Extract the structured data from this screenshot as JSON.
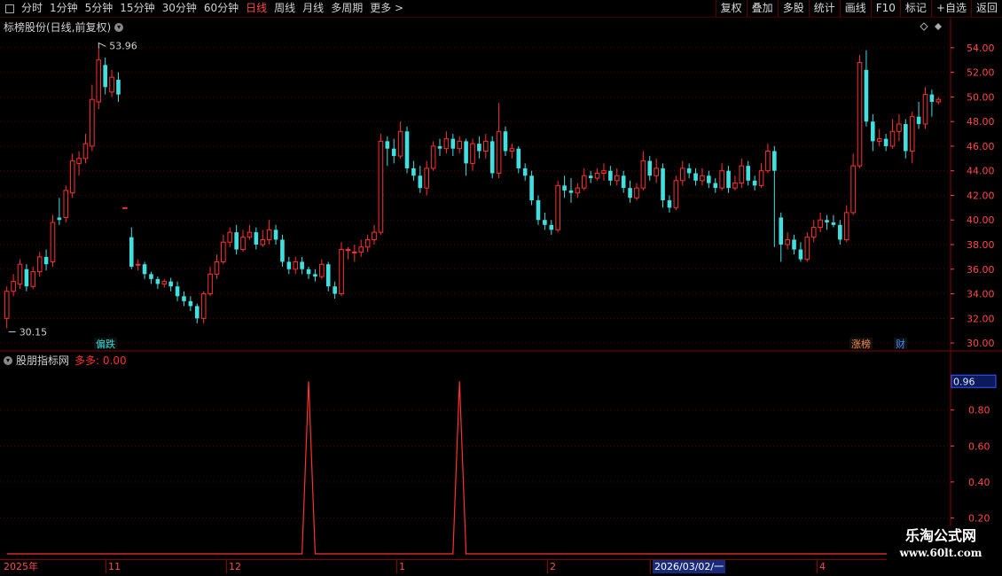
{
  "toolbar": {
    "periods": [
      "分时",
      "1分钟",
      "5分钟",
      "15分钟",
      "30分钟",
      "60分钟",
      "日线",
      "周线",
      "月线",
      "多周期",
      "更多 >"
    ],
    "active_period": "日线",
    "buttons": [
      "复权",
      "叠加",
      "多股",
      "统计",
      "画线",
      "F10",
      "标记",
      "+自选",
      "返回"
    ]
  },
  "main": {
    "title": "标榜股份(日线,前复权)",
    "high_label": "53.96",
    "low_label": "30.15",
    "y_ticks": [
      "54.00",
      "52.00",
      "50.00",
      "48.00",
      "46.00",
      "44.00",
      "42.00",
      "40.00",
      "38.00",
      "36.00",
      "34.00",
      "32.00",
      "30.00"
    ],
    "markers": [
      {
        "label": "偏跌",
        "color": "#33dddd"
      },
      {
        "label": "涨榜",
        "color": "#ff8a4a"
      },
      {
        "label": "财",
        "color": "#3b8cff"
      }
    ]
  },
  "sub": {
    "title": "股朋指标网",
    "indicator": "多多: 0.00",
    "value_box": "0.96",
    "y_ticks": [
      "0.80",
      "0.60",
      "0.40",
      "0.20"
    ]
  },
  "dates": {
    "labels": [
      "2025年",
      "11",
      "12",
      "1",
      "2",
      "2026/03/02/一",
      "4"
    ]
  },
  "logo": {
    "line1": "乐淘公式网",
    "line2": "www.60lt.com"
  },
  "colors": {
    "up": "#ff3030",
    "down": "#40e0e0",
    "grid": "#8a0000",
    "axis": "#ff4848",
    "sub_line": "#ff3030"
  },
  "chart_data": {
    "type": "candlestick",
    "ylim": [
      29.5,
      55
    ],
    "candles": [
      [
        32.0,
        34.2,
        34.6,
        31.2
      ],
      [
        34.2,
        35.0,
        35.6,
        33.8
      ],
      [
        34.8,
        36.4,
        36.8,
        34.4
      ],
      [
        36.0,
        34.6,
        36.4,
        34.2
      ],
      [
        34.6,
        35.8,
        36.2,
        34.4
      ],
      [
        35.8,
        37.0,
        37.4,
        35.4
      ],
      [
        37.0,
        36.4,
        37.6,
        35.9
      ],
      [
        36.6,
        39.8,
        40.4,
        36.2
      ],
      [
        40.2,
        40.0,
        41.8,
        39.6
      ],
      [
        40.2,
        42.4,
        42.8,
        39.8
      ],
      [
        42.2,
        44.8,
        45.4,
        41.8
      ],
      [
        44.6,
        45.0,
        45.6,
        43.6
      ],
      [
        45.0,
        46.2,
        47.0,
        44.6
      ],
      [
        46.0,
        49.8,
        51.0,
        45.6
      ],
      [
        49.6,
        53.0,
        53.96,
        49.0
      ],
      [
        52.6,
        50.8,
        53.2,
        50.2
      ],
      [
        50.4,
        51.6,
        52.2,
        50.0
      ],
      [
        51.4,
        50.2,
        52.0,
        49.6
      ],
      [
        41.0,
        41.0,
        41.0,
        41.0
      ],
      [
        38.6,
        36.2,
        39.4,
        36.0
      ],
      [
        36.4,
        36.4,
        36.8,
        35.9
      ],
      [
        36.4,
        35.6,
        36.6,
        35.2
      ],
      [
        35.6,
        35.2,
        35.8,
        34.8
      ],
      [
        35.2,
        34.8,
        35.4,
        34.4
      ],
      [
        34.8,
        35.0,
        35.2,
        34.5
      ],
      [
        35.0,
        34.6,
        35.3,
        34.2
      ],
      [
        34.6,
        33.8,
        35.0,
        33.4
      ],
      [
        33.8,
        33.4,
        34.2,
        33.0
      ],
      [
        33.4,
        33.0,
        33.8,
        32.6
      ],
      [
        33.0,
        32.0,
        33.2,
        31.6
      ],
      [
        32.0,
        34.0,
        34.2,
        31.6
      ],
      [
        34.0,
        35.6,
        36.2,
        33.8
      ],
      [
        35.6,
        36.6,
        37.2,
        35.2
      ],
      [
        36.6,
        38.2,
        38.8,
        36.4
      ],
      [
        38.2,
        39.0,
        39.4,
        37.8
      ],
      [
        39.0,
        37.6,
        39.6,
        37.2
      ],
      [
        37.6,
        38.6,
        39.2,
        37.4
      ],
      [
        38.6,
        39.0,
        39.6,
        38.4
      ],
      [
        39.0,
        38.0,
        39.4,
        37.6
      ],
      [
        38.0,
        38.4,
        39.2,
        37.8
      ],
      [
        38.4,
        39.2,
        40.0,
        38.0
      ],
      [
        39.2,
        38.4,
        39.6,
        38.0
      ],
      [
        38.4,
        36.6,
        38.8,
        36.2
      ],
      [
        36.6,
        36.0,
        37.0,
        35.6
      ],
      [
        36.0,
        36.6,
        37.0,
        35.6
      ],
      [
        36.6,
        36.0,
        37.0,
        35.6
      ],
      [
        36.0,
        35.6,
        36.2,
        35.2
      ],
      [
        35.6,
        35.4,
        36.0,
        35.0
      ],
      [
        35.4,
        36.4,
        36.8,
        35.2
      ],
      [
        36.4,
        34.6,
        36.6,
        34.2
      ],
      [
        34.6,
        34.0,
        35.0,
        33.6
      ],
      [
        34.0,
        37.6,
        38.2,
        33.8
      ],
      [
        37.6,
        37.6,
        37.8,
        36.8
      ],
      [
        37.4,
        37.4,
        38.0,
        36.6
      ],
      [
        37.4,
        37.8,
        38.4,
        37.0
      ],
      [
        37.8,
        38.4,
        38.8,
        37.4
      ],
      [
        38.4,
        39.0,
        39.6,
        38.0
      ],
      [
        39.0,
        46.4,
        47.0,
        38.8
      ],
      [
        46.4,
        45.8,
        46.8,
        44.4
      ],
      [
        45.8,
        45.2,
        46.6,
        44.6
      ],
      [
        45.2,
        47.2,
        48.0,
        45.0
      ],
      [
        47.2,
        44.2,
        47.6,
        43.8
      ],
      [
        44.2,
        43.6,
        44.8,
        43.2
      ],
      [
        43.6,
        42.6,
        44.4,
        42.2
      ],
      [
        42.6,
        44.2,
        44.8,
        42.0
      ],
      [
        44.2,
        46.0,
        46.4,
        44.0
      ],
      [
        46.0,
        45.8,
        46.6,
        45.2
      ],
      [
        45.8,
        46.6,
        47.2,
        45.4
      ],
      [
        46.6,
        45.8,
        47.0,
        45.2
      ],
      [
        45.8,
        46.4,
        46.8,
        45.4
      ],
      [
        46.4,
        44.6,
        46.6,
        43.6
      ],
      [
        44.6,
        46.2,
        46.6,
        44.0
      ],
      [
        46.2,
        45.6,
        46.8,
        45.0
      ],
      [
        45.6,
        46.4,
        47.0,
        45.0
      ],
      [
        46.4,
        43.8,
        46.8,
        43.4
      ],
      [
        43.8,
        47.2,
        49.5,
        43.4
      ],
      [
        47.2,
        45.6,
        47.6,
        45.2
      ],
      [
        45.6,
        45.8,
        46.2,
        45.0
      ],
      [
        45.8,
        44.2,
        46.0,
        43.8
      ],
      [
        44.2,
        43.6,
        44.6,
        43.2
      ],
      [
        43.6,
        41.6,
        44.0,
        41.2
      ],
      [
        41.6,
        40.0,
        42.0,
        39.6
      ],
      [
        40.0,
        39.6,
        40.6,
        39.2
      ],
      [
        39.6,
        39.2,
        40.0,
        38.8
      ],
      [
        39.2,
        42.8,
        43.2,
        39.0
      ],
      [
        42.8,
        42.4,
        43.6,
        41.8
      ],
      [
        42.4,
        42.2,
        43.4,
        41.4
      ],
      [
        42.2,
        42.6,
        43.0,
        41.8
      ],
      [
        42.6,
        43.6,
        44.2,
        42.4
      ],
      [
        43.6,
        43.4,
        44.0,
        43.0
      ],
      [
        43.4,
        43.8,
        44.2,
        43.2
      ],
      [
        43.8,
        44.0,
        44.6,
        43.2
      ],
      [
        44.0,
        43.2,
        44.4,
        42.8
      ],
      [
        43.2,
        43.6,
        44.2,
        42.8
      ],
      [
        43.6,
        42.6,
        44.0,
        42.2
      ],
      [
        42.6,
        41.8,
        43.2,
        41.4
      ],
      [
        41.8,
        42.6,
        43.0,
        41.6
      ],
      [
        42.6,
        44.8,
        45.6,
        42.4
      ],
      [
        44.8,
        43.6,
        45.2,
        43.2
      ],
      [
        43.6,
        44.2,
        45.0,
        43.0
      ],
      [
        44.2,
        41.6,
        44.6,
        41.0
      ],
      [
        41.6,
        41.0,
        42.0,
        40.6
      ],
      [
        41.0,
        43.2,
        43.6,
        40.8
      ],
      [
        43.2,
        44.2,
        44.8,
        42.8
      ],
      [
        44.2,
        43.8,
        44.6,
        43.4
      ],
      [
        43.8,
        43.2,
        44.2,
        42.8
      ],
      [
        43.2,
        43.6,
        44.2,
        42.8
      ],
      [
        43.6,
        43.0,
        44.0,
        42.6
      ],
      [
        43.0,
        42.6,
        43.4,
        42.2
      ],
      [
        42.6,
        44.0,
        44.6,
        42.4
      ],
      [
        44.0,
        42.6,
        44.4,
        42.2
      ],
      [
        42.6,
        43.0,
        43.6,
        42.4
      ],
      [
        43.0,
        44.4,
        45.0,
        42.6
      ],
      [
        44.4,
        43.2,
        44.8,
        42.8
      ],
      [
        43.2,
        42.8,
        43.6,
        42.4
      ],
      [
        42.8,
        44.0,
        44.6,
        42.6
      ],
      [
        44.0,
        45.6,
        46.2,
        43.8
      ],
      [
        45.6,
        44.0,
        46.0,
        37.8
      ],
      [
        40.2,
        38.0,
        40.6,
        36.6
      ],
      [
        38.0,
        38.4,
        39.0,
        37.6
      ],
      [
        38.4,
        37.6,
        38.8,
        37.2
      ],
      [
        37.6,
        36.8,
        38.2,
        36.6
      ],
      [
        36.8,
        38.6,
        39.0,
        36.6
      ],
      [
        38.6,
        39.4,
        40.0,
        38.2
      ],
      [
        39.4,
        40.0,
        40.6,
        39.0
      ],
      [
        40.0,
        39.8,
        40.4,
        39.2
      ],
      [
        39.8,
        39.6,
        40.4,
        39.4
      ],
      [
        39.6,
        38.4,
        40.0,
        38.0
      ],
      [
        38.4,
        40.6,
        41.2,
        38.2
      ],
      [
        40.6,
        44.4,
        45.4,
        40.4
      ],
      [
        44.4,
        52.8,
        53.4,
        44.2
      ],
      [
        52.2,
        48.0,
        53.8,
        47.6
      ],
      [
        48.0,
        46.4,
        48.6,
        45.6
      ],
      [
        46.4,
        46.6,
        47.4,
        46.0
      ],
      [
        46.6,
        46.0,
        47.0,
        45.6
      ],
      [
        46.0,
        47.2,
        48.2,
        45.8
      ],
      [
        47.2,
        47.8,
        48.6,
        46.4
      ],
      [
        47.8,
        45.6,
        48.2,
        45.0
      ],
      [
        45.6,
        48.4,
        48.8,
        44.6
      ],
      [
        48.4,
        47.8,
        49.6,
        47.4
      ],
      [
        47.8,
        50.2,
        50.8,
        47.4
      ],
      [
        50.2,
        49.6,
        50.6,
        48.4
      ],
      [
        49.6,
        49.8,
        50.0,
        49.4
      ]
    ],
    "sub_series": {
      "spikes_at": [
        46,
        69
      ],
      "peak": 0.96,
      "ylim": [
        0,
        1.05
      ]
    }
  }
}
